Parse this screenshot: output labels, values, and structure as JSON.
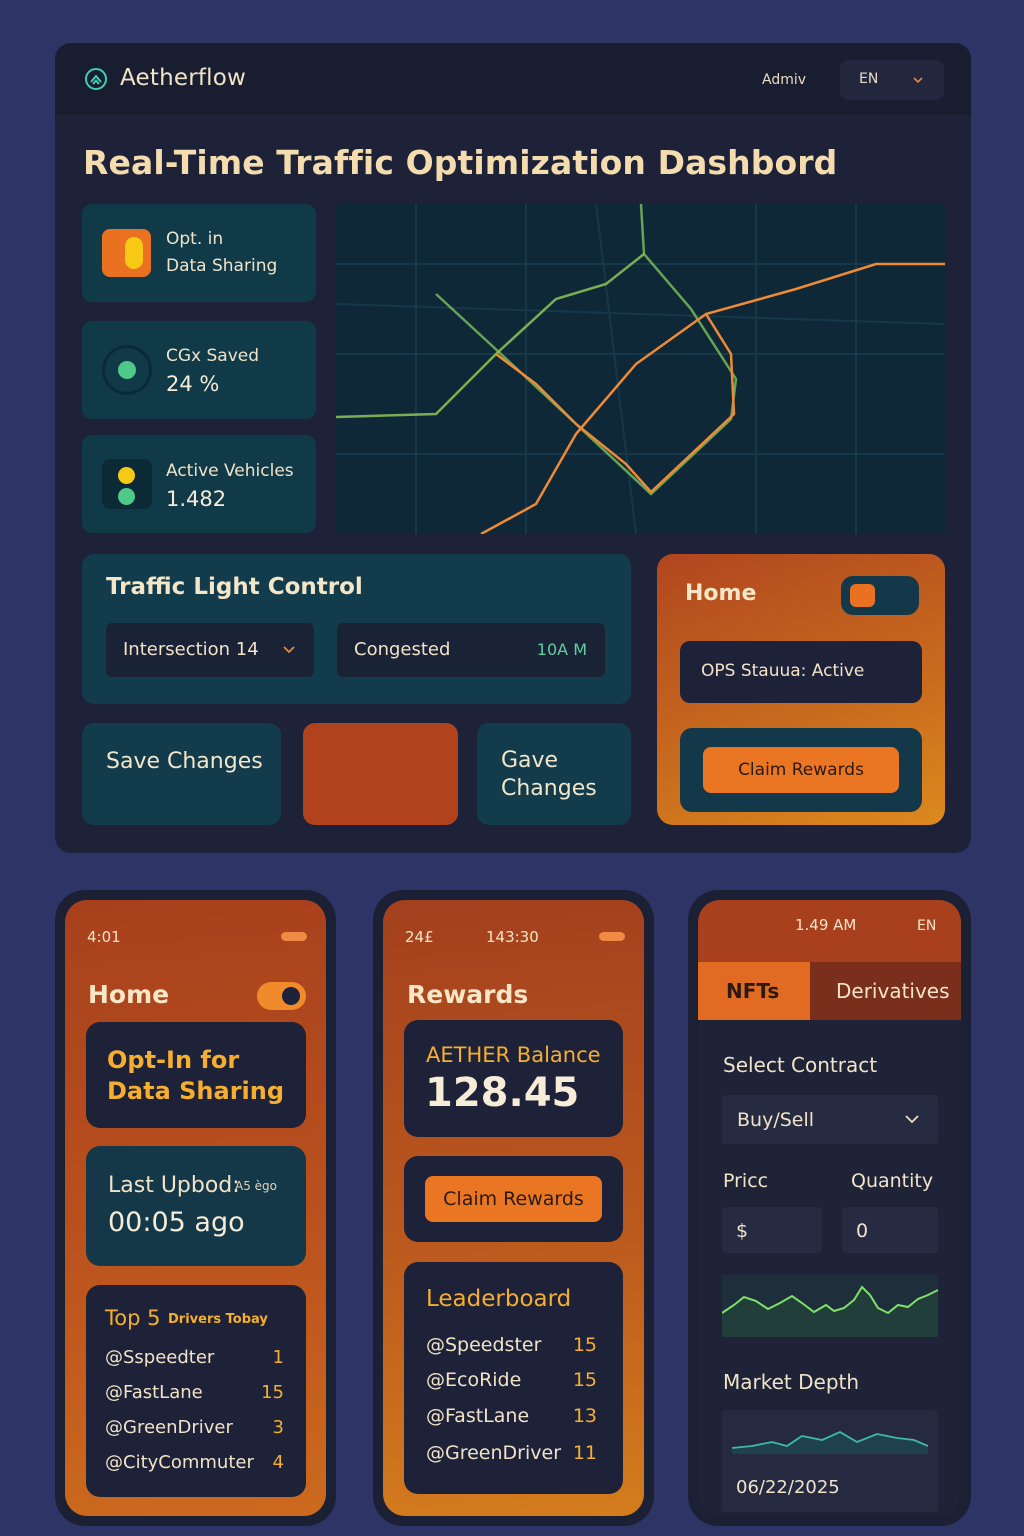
{
  "header": {
    "brand": "Aetherflow",
    "user": "Admiv",
    "language": "EN"
  },
  "dashboard": {
    "title": "Real-Time Traffic Optimization Dashbord",
    "stats": [
      {
        "label_line1": "Opt. in",
        "label_line2": "Data Sharing"
      },
      {
        "label": "CGx Saved",
        "value": "24 %"
      },
      {
        "label": "Active Vehicles",
        "value": "1.482"
      }
    ],
    "traffic_control": {
      "title": "Traffic Light Control",
      "intersection": "Intersection 14",
      "status": "Congested",
      "time": "10A M"
    },
    "buttons": {
      "save": "Save Changes",
      "gave_line1": "Gave",
      "gave_line2": "Changes"
    },
    "home": {
      "title": "Home",
      "ops_status": "OPS Stauua: Active",
      "claim": "Claim Rewards"
    },
    "colors": {
      "accent": "#e9711f",
      "teal": "#123b4b",
      "amber": "#f5ae2e"
    }
  },
  "phone_home": {
    "time": "4:01",
    "title": "Home",
    "optin_line1": "Opt-In for",
    "optin_line2": "Data Sharing",
    "last_update_label": "Last Upbod:",
    "last_update_small": "A5 ègo",
    "last_update_value": "00:05 ago",
    "top_title_big": "Top 5",
    "top_title_small": "Drivers Tobay",
    "drivers": [
      {
        "name": "@Sspeedter",
        "score": "1"
      },
      {
        "name": "@FastLane",
        "score": "15"
      },
      {
        "name": "@GreenDriver",
        "score": "3"
      },
      {
        "name": "@CityCommuter",
        "score": "4"
      }
    ]
  },
  "phone_rewards": {
    "status_left": "24£",
    "time": "143:30",
    "title": "Rewards",
    "balance_label": "AETHER Balance",
    "balance_value": "128.45",
    "claim": "Claim Rewards",
    "leaderboard_title": "Leaderboard",
    "leaderboard": [
      {
        "name": "@Speedster",
        "score": "15"
      },
      {
        "name": "@EcoRide",
        "score": "15"
      },
      {
        "name": "@FastLane",
        "score": "13"
      },
      {
        "name": "@GreenDriver",
        "score": "11"
      }
    ]
  },
  "phone_market": {
    "time": "1.49 AM",
    "language": "EN",
    "tabs": [
      "NFTs",
      "Derivatives"
    ],
    "select_label": "Select Contract",
    "select_value": "Buy/Sell",
    "price_label": "Pricc",
    "quantity_label": "Quantity",
    "price_value": "$",
    "quantity_value": "0",
    "market_depth_label": "Market Depth",
    "date": "06/22/2025"
  }
}
